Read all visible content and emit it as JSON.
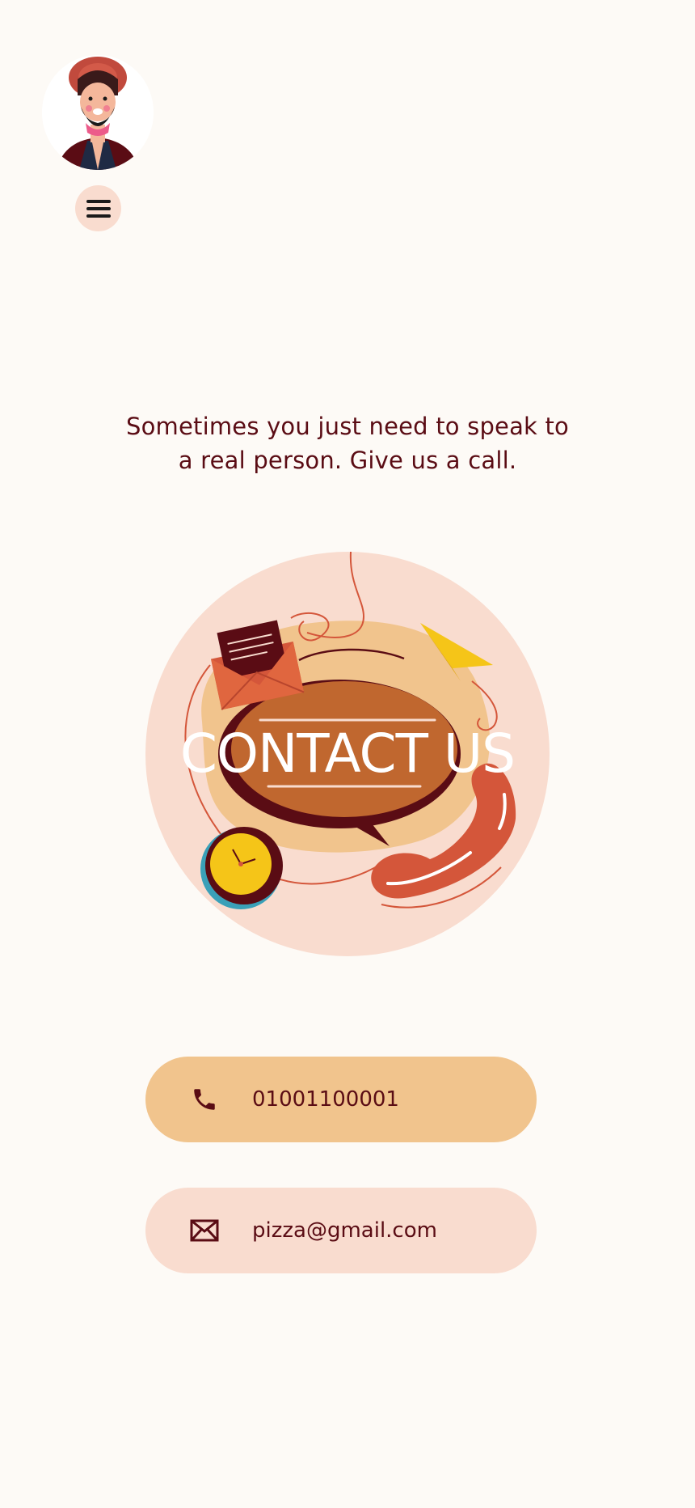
{
  "header": {
    "avatar_icon": "bearded-man-avatar-icon",
    "menu_icon": "hamburger-menu-icon"
  },
  "main": {
    "tagline_line1": "Sometimes you just need to speak to",
    "tagline_line2": "a real person. Give us a call.",
    "hero_title": "CONTACT US",
    "hero_icons": [
      "envelope-icon",
      "paper-plane-icon",
      "speech-bubble-icon",
      "clock-icon",
      "telephone-handset-icon"
    ]
  },
  "contacts": {
    "phone": {
      "icon": "phone-icon",
      "value": "01001100001"
    },
    "email": {
      "icon": "mail-icon",
      "value": "pizza@gmail.com"
    }
  },
  "colors": {
    "background": "#fdfaf6",
    "text": "#5a0c14",
    "peach": "#f9dccf",
    "tan": "#f1c48d",
    "rust": "#c0672f",
    "red_orange": "#d4563a",
    "yellow": "#f5c518"
  }
}
